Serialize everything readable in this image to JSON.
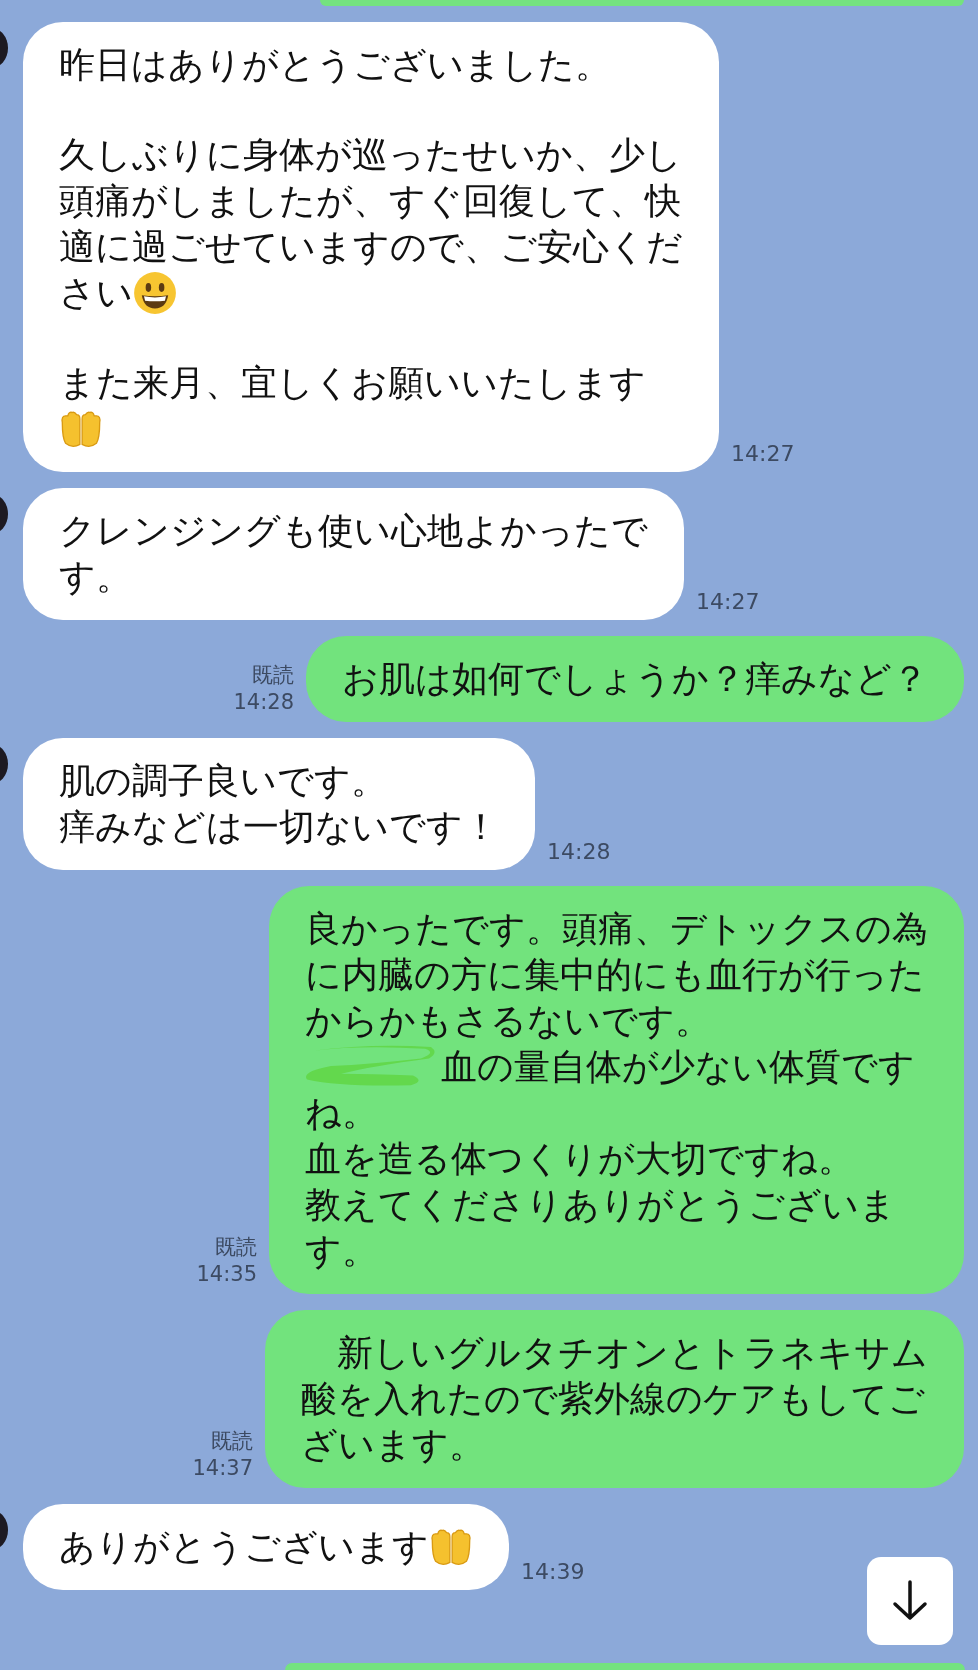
{
  "messages": [
    {
      "kind": "received",
      "time": "14:27",
      "paragraphs": [
        [
          [
            {
              "kind": "text",
              "text": "昨日はありがとうございました。"
            }
          ]
        ],
        [
          [
            {
              "kind": "text",
              "text": "久しぶりに身体が巡ったせいか、少し"
            }
          ],
          [
            {
              "kind": "text",
              "text": "頭痛がしましたが、すぐ回復して、快"
            }
          ],
          [
            {
              "kind": "text",
              "text": "適に過ごせていますので、ご安心くだ"
            }
          ],
          [
            {
              "kind": "text",
              "text": "さい"
            },
            {
              "kind": "grin"
            }
          ]
        ],
        [
          [
            {
              "kind": "text",
              "text": "また来月、宜しくお願いいたします"
            }
          ],
          [
            {
              "kind": "hands"
            }
          ]
        ]
      ]
    },
    {
      "kind": "received",
      "time": "14:27",
      "paragraphs": [
        [
          [
            {
              "kind": "text",
              "text": "クレンジングも使い心地よかったで"
            }
          ],
          [
            {
              "kind": "text",
              "text": "す。"
            }
          ]
        ]
      ]
    },
    {
      "kind": "sent",
      "read": "既読",
      "time": "14:28",
      "paragraphs": [
        [
          [
            {
              "kind": "text",
              "text": "お肌は如何でしょうか？痒みなど？"
            }
          ]
        ]
      ]
    },
    {
      "kind": "received",
      "time": "14:28",
      "paragraphs": [
        [
          [
            {
              "kind": "text",
              "text": "肌の調子良いです。"
            }
          ],
          [
            {
              "kind": "text",
              "text": "痒みなどは一切ないです！"
            }
          ]
        ]
      ]
    },
    {
      "kind": "sent",
      "read": "既読",
      "time": "14:35",
      "paragraphs": [
        [
          [
            {
              "kind": "text",
              "text": "良かったです。頭痛、デトックスの為"
            }
          ],
          [
            {
              "kind": "text",
              "text": "に内臓の方に集中的にも血行が行った"
            }
          ],
          [
            {
              "kind": "text",
              "text": "からかもさるないです。"
            }
          ],
          [
            {
              "kind": "scribble"
            },
            {
              "kind": "text",
              "text": "血の量自体が少ない体質です"
            }
          ],
          [
            {
              "kind": "text",
              "text": "ね。"
            }
          ],
          [
            {
              "kind": "text",
              "text": "血を造る体つくりが大切ですね。"
            }
          ],
          [
            {
              "kind": "text",
              "text": "教えてくださりありがとうございま"
            }
          ],
          [
            {
              "kind": "text",
              "text": "す。"
            }
          ]
        ]
      ]
    },
    {
      "kind": "sent",
      "read": "既読",
      "time": "14:37",
      "paragraphs": [
        [
          [
            {
              "kind": "text",
              "text": "　新しいグルタチオンとトラネキサム"
            }
          ],
          [
            {
              "kind": "text",
              "text": "酸を入れたので紫外線のケアもしてご"
            }
          ],
          [
            {
              "kind": "text",
              "text": "ざいます。"
            }
          ]
        ]
      ]
    },
    {
      "kind": "received",
      "time": "14:39",
      "paragraphs": [
        [
          [
            {
              "kind": "text",
              "text": "ありがとうございます"
            },
            {
              "kind": "hands"
            }
          ]
        ]
      ]
    }
  ]
}
